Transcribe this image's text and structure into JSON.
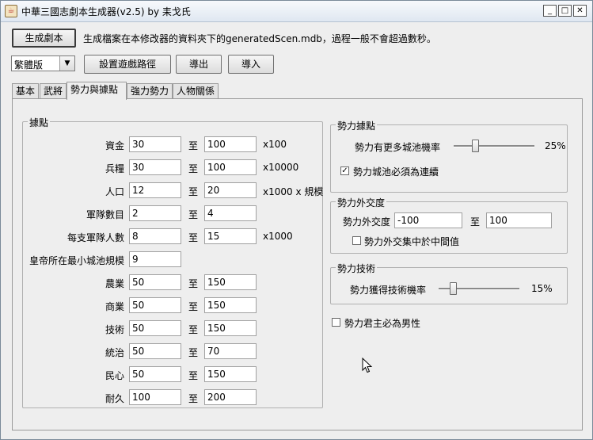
{
  "window": {
    "title": "中華三國志劇本生成器(v2.5) by 耒戈氏",
    "controls": {
      "minimize": "_",
      "maximize": "□",
      "close": "✕"
    }
  },
  "toolbar": {
    "generate_label": "生成劇本",
    "generate_info": "生成檔案在本修改器的資料夾下的generatedScen.mdb，過程一般不會超過數秒。",
    "language_selected": "繁體版",
    "set_path_label": "設置遊戲路徑",
    "export_label": "導出",
    "import_label": "導入"
  },
  "tabs": [
    {
      "label": "基本",
      "active": false
    },
    {
      "label": "武將",
      "active": false
    },
    {
      "label": "勢力與據點",
      "active": true
    },
    {
      "label": "強力勢力",
      "active": false
    },
    {
      "label": "人物關係",
      "active": false
    }
  ],
  "city": {
    "title": "據點",
    "to": "至",
    "rows": [
      {
        "label": "資金",
        "min": "30",
        "max": "100",
        "unit": "x100"
      },
      {
        "label": "兵糧",
        "min": "30",
        "max": "100",
        "unit": "x10000"
      },
      {
        "label": "人口",
        "min": "12",
        "max": "20",
        "unit": "x1000 x 規模"
      },
      {
        "label": "軍隊數目",
        "min": "2",
        "max": "4",
        "unit": ""
      },
      {
        "label": "每支軍隊人數",
        "min": "8",
        "max": "15",
        "unit": "x1000"
      },
      {
        "label": "皇帝所在最小城池規模",
        "min": "9",
        "max": null,
        "unit": ""
      },
      {
        "label": "農業",
        "min": "50",
        "max": "150",
        "unit": ""
      },
      {
        "label": "商業",
        "min": "50",
        "max": "150",
        "unit": ""
      },
      {
        "label": "技術",
        "min": "50",
        "max": "150",
        "unit": ""
      },
      {
        "label": "統治",
        "min": "50",
        "max": "70",
        "unit": ""
      },
      {
        "label": "民心",
        "min": "50",
        "max": "150",
        "unit": ""
      },
      {
        "label": "耐久",
        "min": "100",
        "max": "200",
        "unit": ""
      }
    ]
  },
  "force_city": {
    "title": "勢力據點",
    "slider_label": "勢力有更多城池機率",
    "slider_value": 25,
    "slider_value_text": "25%",
    "checkbox_label": "勢力城池必須為連續",
    "checkbox_checked": true
  },
  "diplomacy": {
    "title": "勢力外交度",
    "label": "勢力外交度",
    "min": "-100",
    "to": "至",
    "max": "100",
    "checkbox_label": "勢力外交集中於中間值",
    "checkbox_checked": false
  },
  "tech": {
    "title": "勢力技術",
    "slider_label": "勢力獲得技術機率",
    "slider_value": 15,
    "slider_value_text": "15%"
  },
  "ruler_male": {
    "label": "勢力君主必為男性",
    "checked": false
  }
}
